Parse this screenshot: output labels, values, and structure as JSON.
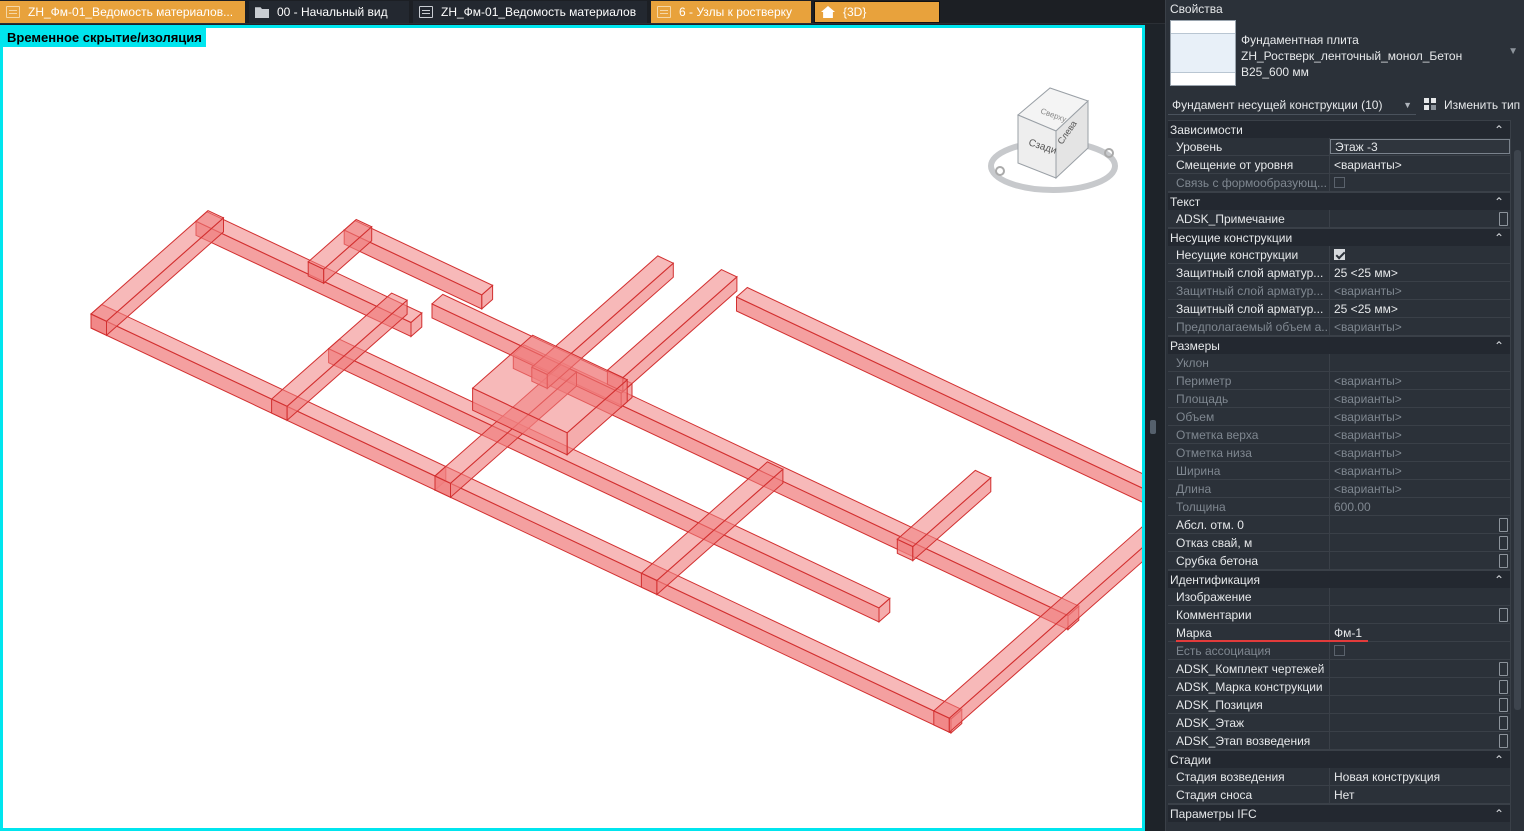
{
  "tabs": [
    {
      "label": "ZH_Фм-01_Ведомость материалов...",
      "icon": "sheet-icon"
    },
    {
      "label": "00 - Начальный вид",
      "icon": "folder-icon"
    },
    {
      "label": "ZH_Фм-01_Ведомость материалов",
      "icon": "sheet-icon"
    },
    {
      "label": "6 - Узлы к ростверку",
      "icon": "sheet-icon"
    },
    {
      "label": "{3D}",
      "icon": "house-icon"
    }
  ],
  "viewport": {
    "isolation_label": "Временное скрытие/изоляция",
    "viewcube": {
      "face_back": "Сзади",
      "face_left": "Слева",
      "face_top": "Сверху"
    },
    "element_color": "#f08080",
    "border_color": "#00e5ee"
  },
  "properties": {
    "title": "Свойства",
    "type_name_line1": "Фундаментная плита",
    "type_name_line2": "ZH_Ростверк_ленточный_монол_Бетон B25_600 мм",
    "selector": "Фундамент несущей конструкции (10)",
    "edit_type": "Изменить тип",
    "groups": [
      {
        "title": "Зависимости",
        "rows": [
          {
            "name": "Уровень",
            "value": "Этаж -3",
            "boxed": true
          },
          {
            "name": "Смещение от уровня",
            "value": "<варианты>"
          },
          {
            "name": "Связь с формообразующ...",
            "value": "",
            "check": "off",
            "dim": true
          }
        ]
      },
      {
        "title": "Текст",
        "rows": [
          {
            "name": "ADSK_Примечание",
            "value": "",
            "button": true
          }
        ]
      },
      {
        "title": "Несущие конструкции",
        "rows": [
          {
            "name": "Несущие конструкции",
            "value": "",
            "check": "on"
          },
          {
            "name": "Защитный слой арматур...",
            "value": "25 <25 мм>"
          },
          {
            "name": "Защитный слой арматур...",
            "value": "<варианты>",
            "dim": true
          },
          {
            "name": "Защитный слой арматур...",
            "value": "25 <25 мм>"
          },
          {
            "name": "Предполагаемый объем а...",
            "value": "<варианты>",
            "dim": true
          }
        ]
      },
      {
        "title": "Размеры",
        "rows": [
          {
            "name": "Уклон",
            "value": "",
            "dim": true
          },
          {
            "name": "Периметр",
            "value": "<варианты>",
            "dim": true
          },
          {
            "name": "Площадь",
            "value": "<варианты>",
            "dim": true
          },
          {
            "name": "Объем",
            "value": "<варианты>",
            "dim": true
          },
          {
            "name": "Отметка верха",
            "value": "<варианты>",
            "dim": true
          },
          {
            "name": "Отметка низа",
            "value": "<варианты>",
            "dim": true
          },
          {
            "name": "Ширина",
            "value": "<варианты>",
            "dim": true
          },
          {
            "name": "Длина",
            "value": "<варианты>",
            "dim": true
          },
          {
            "name": "Толщина",
            "value": "600.00",
            "dim": true
          },
          {
            "name": "Абсл. отм. 0",
            "value": "",
            "button": true
          },
          {
            "name": "Отказ свай, м",
            "value": "",
            "button": true
          },
          {
            "name": "Срубка бетона",
            "value": "",
            "button": true
          }
        ]
      },
      {
        "title": "Идентификация",
        "rows": [
          {
            "name": "Изображение",
            "value": ""
          },
          {
            "name": "Комментарии",
            "value": "",
            "button": true
          },
          {
            "name": "Марка",
            "value": "Фм-1"
          },
          {
            "name": "Есть ассоциация",
            "value": "",
            "check": "off",
            "dim": true
          },
          {
            "name": "ADSK_Комплект чертежей",
            "value": "",
            "button": true
          },
          {
            "name": "ADSK_Марка конструкции",
            "value": "",
            "button": true
          },
          {
            "name": "ADSK_Позиция",
            "value": "",
            "button": true
          },
          {
            "name": "ADSK_Этаж",
            "value": "",
            "button": true
          },
          {
            "name": "ADSK_Этап возведения",
            "value": "",
            "button": true
          }
        ]
      },
      {
        "title": "Стадии",
        "rows": [
          {
            "name": "Стадия возведения",
            "value": "Новая конструкция"
          },
          {
            "name": "Стадия сноса",
            "value": "Нет"
          }
        ]
      },
      {
        "title": "Параметры IFC",
        "rows": []
      }
    ]
  }
}
